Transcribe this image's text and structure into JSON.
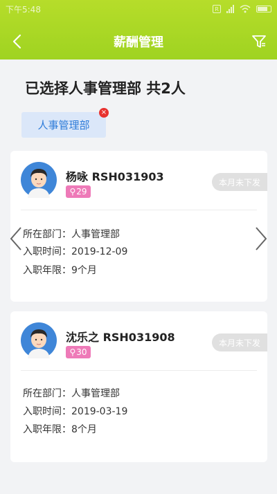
{
  "status_bar": {
    "time": "下午5:48"
  },
  "header": {
    "title": "薪酬管理"
  },
  "selection": {
    "text": "已选择人事管理部  共2人",
    "chip_label": "人事管理部",
    "chip_close": "×"
  },
  "employees": [
    {
      "name": "杨咏 RSH031903",
      "score": "29",
      "status": "本月未下发",
      "dept_line": "所在部门：人事管理部",
      "date_line": "入职时间：2019-12-09",
      "years_line": "入职年限：9个月"
    },
    {
      "name": "沈乐之 RSH031908",
      "score": "30",
      "status": "本月未下发",
      "dept_line": "所在部门：人事管理部",
      "date_line": "入职时间：2019-03-19",
      "years_line": "入职年限：8个月"
    }
  ],
  "icons": {
    "back": "chevron-left-icon",
    "filter": "filter-icon",
    "prev": "chevron-left-icon",
    "next": "chevron-right-icon"
  },
  "colors": {
    "header_green": "#9fd321",
    "chip_bg": "#dbe7f9",
    "chip_text": "#2d7bd9",
    "badge_pink": "#ee7ab8",
    "close_red": "#e8322f"
  }
}
